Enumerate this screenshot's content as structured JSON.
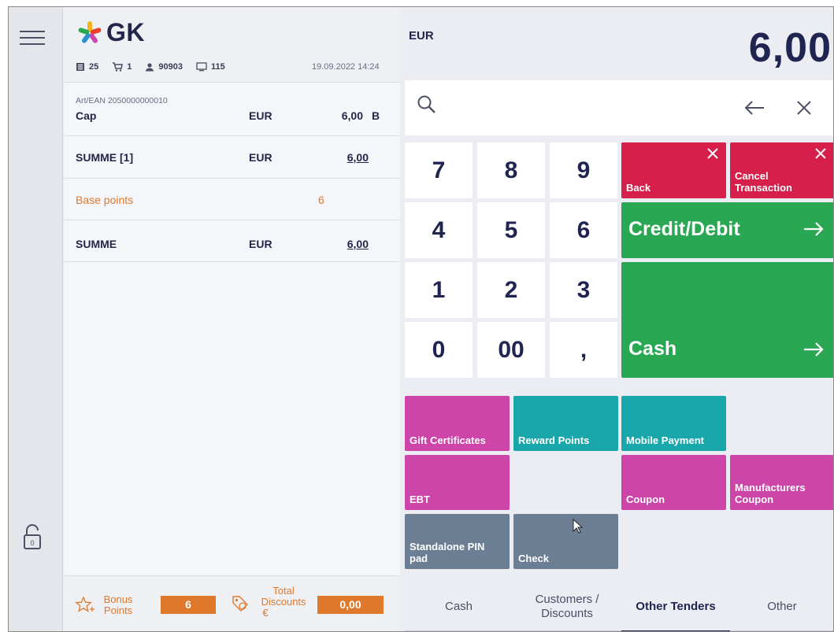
{
  "header": {
    "logo_text": "GK",
    "stats": {
      "receipts": "25",
      "cart": "1",
      "user": "90903",
      "workstation": "115"
    },
    "datetime": "19.09.2022 14:24"
  },
  "receipt_lines": {
    "item": {
      "sub": "Art/EAN 2050000000010",
      "name": "Cap",
      "currency": "EUR",
      "amount": "6,00",
      "flag": "B"
    },
    "subtotal": {
      "name": "SUMME [1]",
      "currency": "EUR",
      "amount": "6,00"
    },
    "base_points": {
      "name": "Base points",
      "value": "6"
    },
    "total": {
      "name": "SUMME",
      "currency": "EUR",
      "amount": "6,00"
    }
  },
  "footer": {
    "bonus_label_1": "Bonus",
    "bonus_label_2": "Points",
    "bonus_value": "6",
    "discount_label_1": "Total",
    "discount_label_2": "Discounts",
    "discount_label_3": "€",
    "discount_value": "0,00"
  },
  "amount": {
    "currency": "EUR",
    "value": "6,00"
  },
  "keypad": [
    "7",
    "8",
    "9",
    "4",
    "5",
    "6",
    "1",
    "2",
    "3",
    "0",
    "00",
    ","
  ],
  "actions": {
    "back": "Back",
    "cancel_1": "Cancel",
    "cancel_2": "Transaction",
    "credit": "Credit/Debit",
    "cash": "Cash"
  },
  "tenders": {
    "gift": "Gift Certificates",
    "reward": "Reward Points",
    "mobile": "Mobile Payment",
    "ebt": "EBT",
    "coupon": "Coupon",
    "manufacturers_1": "Manufacturers",
    "manufacturers_2": "Coupon",
    "standalone_1": "Standalone PIN",
    "standalone_2": "pad",
    "check": "Check"
  },
  "tabs": {
    "cash": "Cash",
    "customers_1": "Customers /",
    "customers_2": "Discounts",
    "other_tenders": "Other Tenders",
    "other": "Other"
  },
  "colors": {
    "red": "#d61f4a",
    "green": "#2aa753",
    "magenta": "#cd45a8",
    "teal": "#1aa7ac",
    "slate": "#6c7e94",
    "orange": "#e0782b",
    "navy": "#1f2450"
  }
}
